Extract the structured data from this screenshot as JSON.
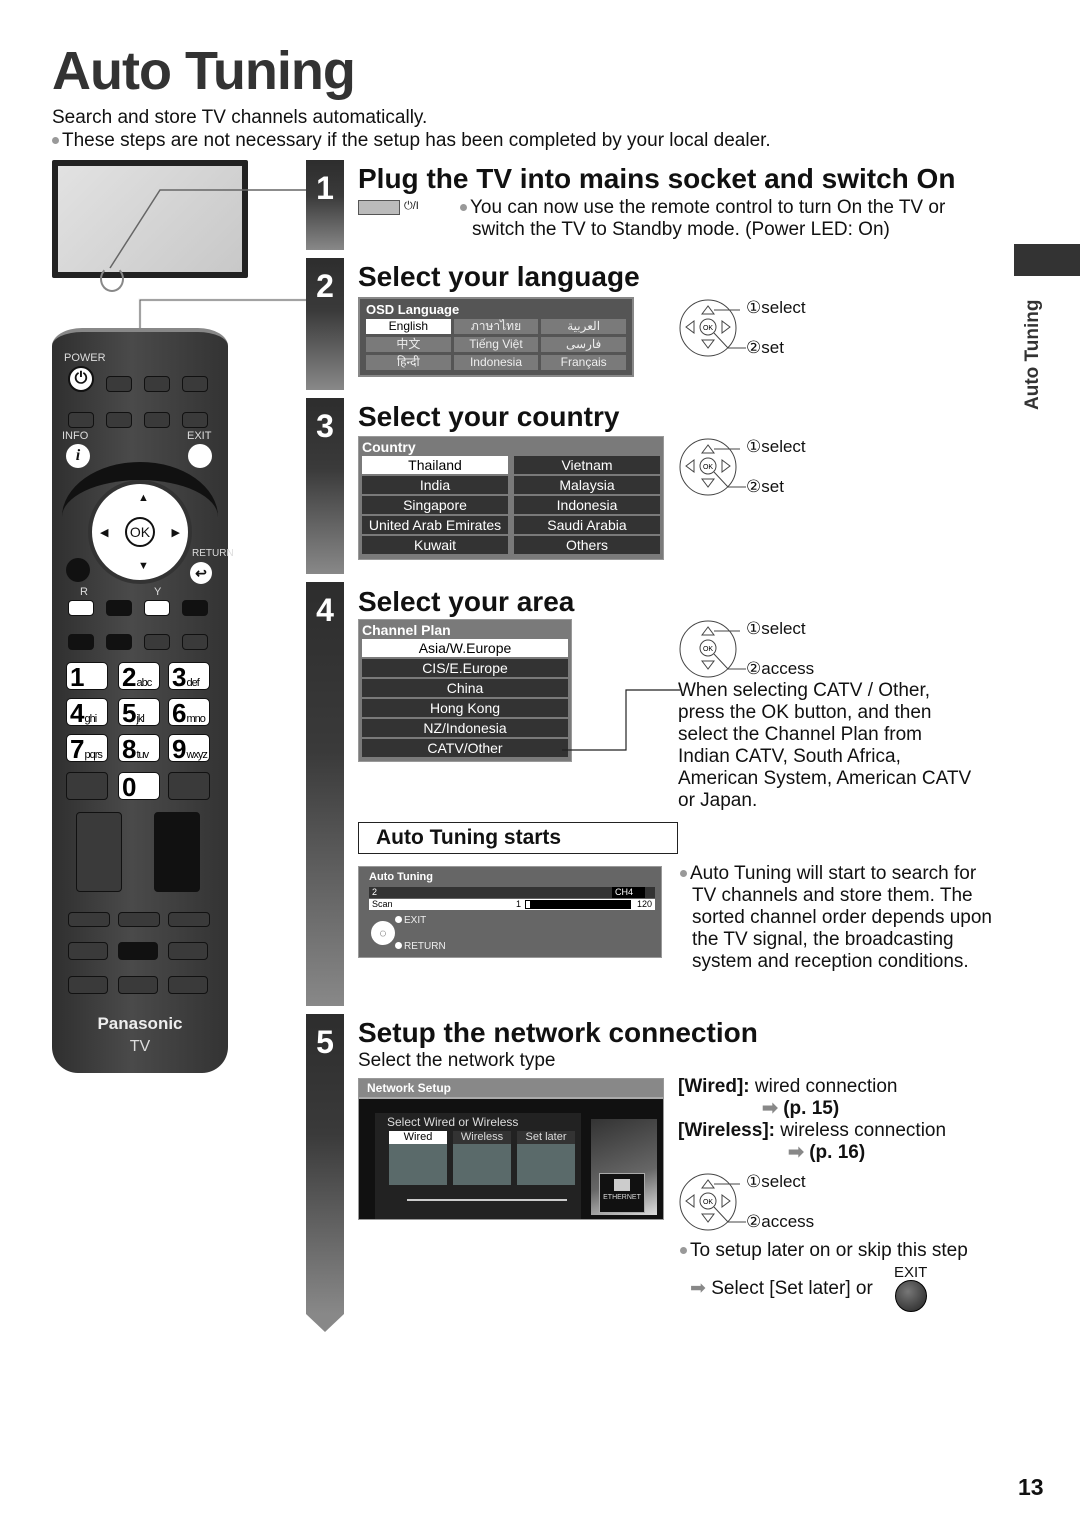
{
  "page": {
    "title": "Auto Tuning",
    "intro": "Search and store TV channels automatically.",
    "note": "These steps are not necessary if the setup has been completed by your local dealer.",
    "side_tab": "Auto Tuning",
    "page_number": "13"
  },
  "remote": {
    "brand": "Panasonic",
    "model": "TV",
    "labels": {
      "power": "POWER",
      "info": "INFO",
      "exit": "EXIT",
      "return": "RETURN",
      "ok": "OK",
      "r": "R",
      "y": "Y"
    },
    "number_keys": [
      {
        "digit": "1",
        "letters": ""
      },
      {
        "digit": "2",
        "letters": "abc"
      },
      {
        "digit": "3",
        "letters": "def"
      },
      {
        "digit": "4",
        "letters": "ghi"
      },
      {
        "digit": "5",
        "letters": "jkl"
      },
      {
        "digit": "6",
        "letters": "mno"
      },
      {
        "digit": "7",
        "letters": "pqrs"
      },
      {
        "digit": "8",
        "letters": "tuv"
      },
      {
        "digit": "9",
        "letters": "wxyz"
      },
      {
        "digit": "0",
        "letters": ""
      }
    ]
  },
  "steps": [
    {
      "number": "1",
      "title": "Plug the TV into mains socket and switch On",
      "power_symbol": "⏻/I",
      "text": "You can now use the remote control to turn On the TV or switch the TV to Standby mode. (Power LED: On)"
    },
    {
      "number": "2",
      "title": "Select your language",
      "menu_title": "OSD Language",
      "options": [
        "English",
        "ภาษาไทย",
        "العربية",
        "中文",
        "Tiếng Việt",
        "فارسی",
        "हिन्दी",
        "Indonesia",
        "Français"
      ],
      "selected": "English",
      "nav": {
        "one": "①select",
        "two": "②set"
      }
    },
    {
      "number": "3",
      "title": "Select your country",
      "menu_title": "Country",
      "options": [
        "Thailand",
        "Vietnam",
        "India",
        "Malaysia",
        "Singapore",
        "Indonesia",
        "United Arab Emirates",
        "Saudi Arabia",
        "Kuwait",
        "Others"
      ],
      "selected": "Thailand",
      "nav": {
        "one": "①select",
        "two": "②set"
      }
    },
    {
      "number": "4",
      "title": "Select your area",
      "menu_title": "Channel Plan",
      "options": [
        "Asia/W.Europe",
        "CIS/E.Europe",
        "China",
        "Hong Kong",
        "NZ/Indonesia",
        "CATV/Other"
      ],
      "selected": "Asia/W.Europe",
      "nav": {
        "one": "①select",
        "two": "②access"
      },
      "catv_note": "When selecting CATV / Other, press the OK button, and then select the Channel Plan from Indian CATV, South Africa, American System, American CATV or Japan.",
      "sub_heading": "Auto Tuning starts",
      "tuning_screen": {
        "title": "Auto Tuning",
        "row1_left": "2",
        "row1_right": "CH4",
        "scan_label": "Scan",
        "scan_min": "1",
        "scan_max": "120",
        "progress_fraction": 0.0,
        "exit": "EXIT",
        "return": "RETURN"
      },
      "tuning_note": "Auto Tuning will start to search for TV channels and store them. The sorted channel order depends upon the TV signal, the broadcasting system and reception conditions."
    },
    {
      "number": "5",
      "title": "Setup the network connection",
      "subtitle": "Select the network type",
      "screen": {
        "title": "Network Setup",
        "prompt": "Select Wired or Wireless",
        "options": [
          "Wired",
          "Wireless",
          "Set later"
        ],
        "selected": "Wired",
        "port_label": "ETHERNET"
      },
      "wired_label": "[Wired]:",
      "wired_text": "wired connection",
      "wired_ref": "(p. 15)",
      "wireless_label": "[Wireless]:",
      "wireless_text": "wireless connection",
      "wireless_ref": "(p. 16)",
      "nav": {
        "one": "①select",
        "two": "②access"
      },
      "skip_note": "To setup later on or skip this step",
      "skip_action": "Select [Set later] or",
      "exit_label": "EXIT"
    }
  ]
}
